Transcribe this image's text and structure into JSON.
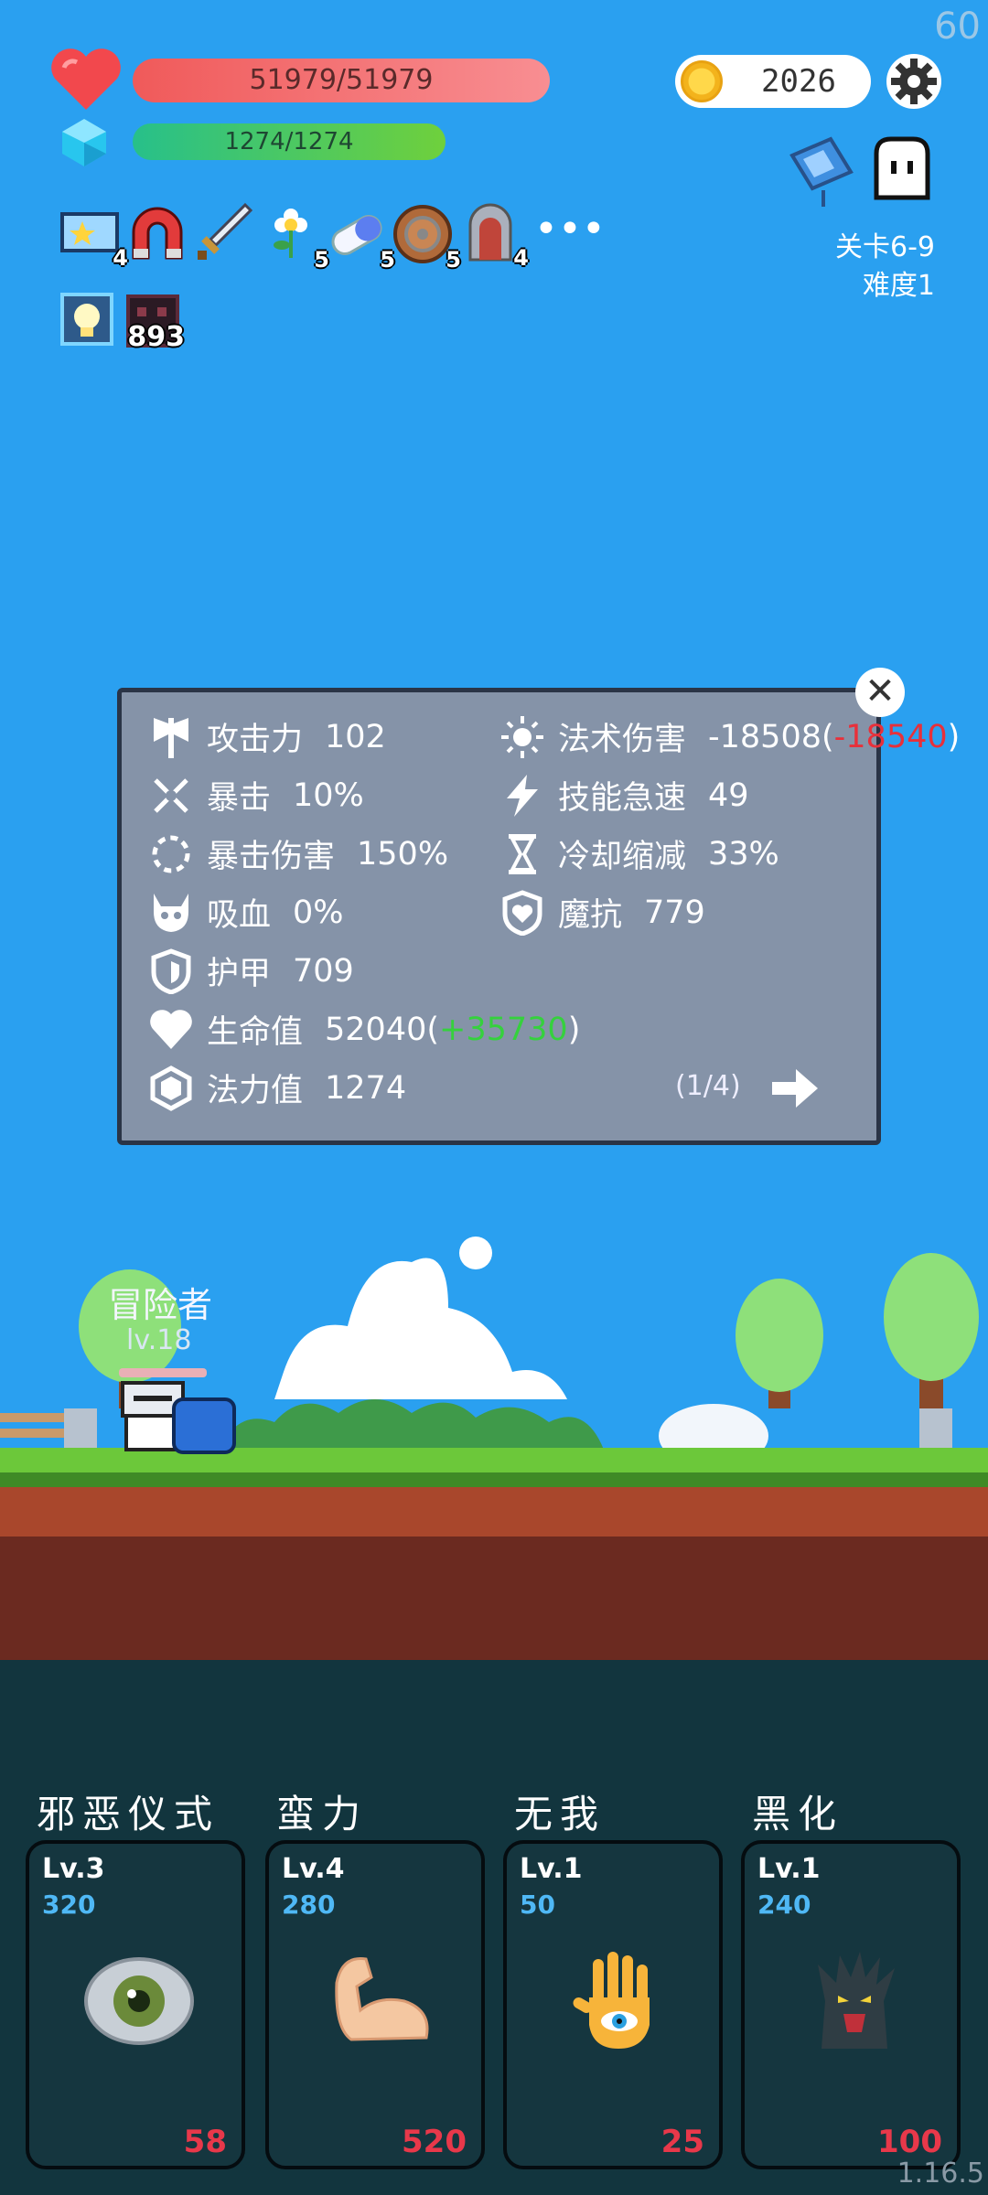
{
  "hud": {
    "fps": "60",
    "hp_text": "51979/51979",
    "mp_text": "1274/1274",
    "coins": "2026",
    "stage": "关卡6-9",
    "difficulty": "难度1"
  },
  "items": [
    {
      "icon": "ticket-star-icon",
      "count": "4"
    },
    {
      "icon": "magnet-icon",
      "count": ""
    },
    {
      "icon": "sword-icon",
      "count": ""
    },
    {
      "icon": "flower-icon",
      "count": "5"
    },
    {
      "icon": "pill-icon",
      "count": "5"
    },
    {
      "icon": "round-shield-icon",
      "count": "5"
    },
    {
      "icon": "tombstone-icon",
      "count": "4"
    }
  ],
  "buffs": [
    {
      "icon": "lightbulb-icon",
      "count": ""
    },
    {
      "icon": "dark-block-icon",
      "count": "893"
    }
  ],
  "stats": {
    "attack": {
      "label": "攻击力",
      "value": "102"
    },
    "crit": {
      "label": "暴击",
      "value": "10%"
    },
    "crit_damage": {
      "label": "暴击伤害",
      "value": "150%"
    },
    "lifesteal": {
      "label": "吸血",
      "value": "0%"
    },
    "armor": {
      "label": "护甲",
      "value": "709"
    },
    "hp": {
      "label": "生命值",
      "value": "52040",
      "bonus_open": "(",
      "bonus": "+35730",
      "bonus_close": ")"
    },
    "mana": {
      "label": "法力值",
      "value": "1274"
    },
    "spell_damage": {
      "label": "法术伤害",
      "value": "-18508",
      "bonus_open": "(",
      "bonus": "-18540",
      "bonus_close": ")"
    },
    "ability_haste": {
      "label": "技能急速",
      "value": "49"
    },
    "cdr": {
      "label": "冷却缩减",
      "value": "33%"
    },
    "magic_resist": {
      "label": "魔抗",
      "value": "779"
    }
  },
  "panel": {
    "close_label": "✕",
    "page": "(1/4)"
  },
  "hero": {
    "name": "冒险者",
    "level": "lv.18"
  },
  "skills": [
    {
      "title": "邪恶仪式",
      "level": "Lv.3",
      "cost": "320",
      "count": "58",
      "icon": "eye-icon"
    },
    {
      "title": "蛮力",
      "level": "Lv.4",
      "cost": "280",
      "count": "520",
      "icon": "flexed-arm-icon"
    },
    {
      "title": "无我",
      "level": "Lv.1",
      "cost": "50",
      "count": "25",
      "icon": "eye-hand-icon"
    },
    {
      "title": "黑化",
      "level": "Lv.1",
      "cost": "240",
      "count": "100",
      "icon": "dark-tree-icon"
    }
  ],
  "version": "1.16.5",
  "colors": {
    "sky": "#2aa0f0",
    "hp": "#f05a5a",
    "mp": "#27c08a",
    "panel": "#8593a8",
    "bonus_green": "#35d13d",
    "bonus_red": "#e8303a",
    "skill_cost": "#4fb8f5",
    "skill_count": "#e8384a"
  }
}
